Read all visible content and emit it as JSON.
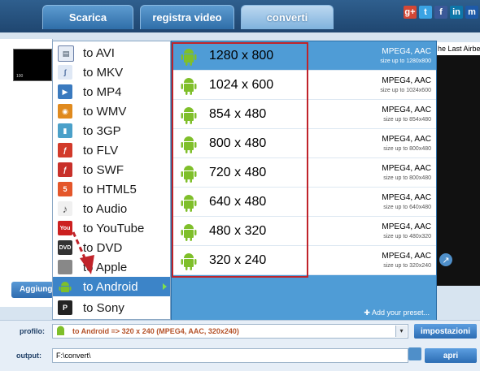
{
  "tabs": [
    {
      "label": "Scarica"
    },
    {
      "label": "registra video"
    },
    {
      "label": "converti"
    }
  ],
  "social_icons": [
    "google-plus-icon",
    "twitter-icon",
    "facebook-icon",
    "linkedin-icon",
    "myspace-icon"
  ],
  "background": {
    "right_label": "he Last Airber",
    "thumb_caption": "100",
    "add_button": "Aggiunge"
  },
  "menu": {
    "items": [
      {
        "label": "to AVI",
        "icon": "avi-file-icon",
        "color": "#6a7fa8"
      },
      {
        "label": "to MKV",
        "icon": "mkv-file-icon",
        "color": "#4a6a9e"
      },
      {
        "label": "to MP4",
        "icon": "mp4-file-icon",
        "color": "#3a7abf"
      },
      {
        "label": "to WMV",
        "icon": "wmv-file-icon",
        "color": "#e08a1e"
      },
      {
        "label": "to 3GP",
        "icon": "3gp-file-icon",
        "color": "#4aa0c9"
      },
      {
        "label": "to FLV",
        "icon": "flv-file-icon",
        "color": "#d23a2a"
      },
      {
        "label": "to SWF",
        "icon": "swf-file-icon",
        "color": "#c8302a"
      },
      {
        "label": "to HTML5",
        "icon": "html5-icon",
        "color": "#e4562a"
      },
      {
        "label": "to Audio",
        "icon": "music-note-icon",
        "color": "#9a9a9a"
      },
      {
        "label": "to YouTube",
        "icon": "youtube-icon",
        "color": "#cc2020"
      },
      {
        "label": "to DVD",
        "icon": "dvd-icon",
        "color": "#333333"
      },
      {
        "label": "to Apple",
        "icon": "apple-icon",
        "color": "#888888"
      },
      {
        "label": "to Android",
        "icon": "android-icon",
        "color": "#7fbf2a",
        "selected": true
      },
      {
        "label": "to Sony",
        "icon": "playstation-icon",
        "color": "#222222"
      }
    ]
  },
  "presets": {
    "items": [
      {
        "resolution": "1280 x 800",
        "codec": "MPEG4, AAC",
        "size": "size up to 1280x800",
        "selected": true
      },
      {
        "resolution": "1024 x 600",
        "codec": "MPEG4, AAC",
        "size": "size up to 1024x600"
      },
      {
        "resolution": "854 x 480",
        "codec": "MPEG4, AAC",
        "size": "size up to 854x480"
      },
      {
        "resolution": "800 x 480",
        "codec": "MPEG4, AAC",
        "size": "size up to 800x480"
      },
      {
        "resolution": "720 x 480",
        "codec": "MPEG4, AAC",
        "size": "size up to 800x480"
      },
      {
        "resolution": "640 x 480",
        "codec": "MPEG4, AAC",
        "size": "size up to 640x480"
      },
      {
        "resolution": "480 x 320",
        "codec": "MPEG4, AAC",
        "size": "size up to 480x320"
      },
      {
        "resolution": "320 x 240",
        "codec": "MPEG4, AAC",
        "size": "size up to 320x240"
      }
    ],
    "add_label": "Add your preset..."
  },
  "bottom": {
    "profile_label": "profilo:",
    "profile_value": "to Android => 320 x 240 (MPEG4, AAC, 320x240)",
    "settings_button": "impostazioni",
    "output_label": "output:",
    "output_value": "F:\\convert\\",
    "open_button": "apri"
  },
  "colors": {
    "accent": "#3c84c8",
    "highlight_border": "#c0232a",
    "android_green": "#7fbf2a",
    "profile_text": "#b5532a"
  }
}
